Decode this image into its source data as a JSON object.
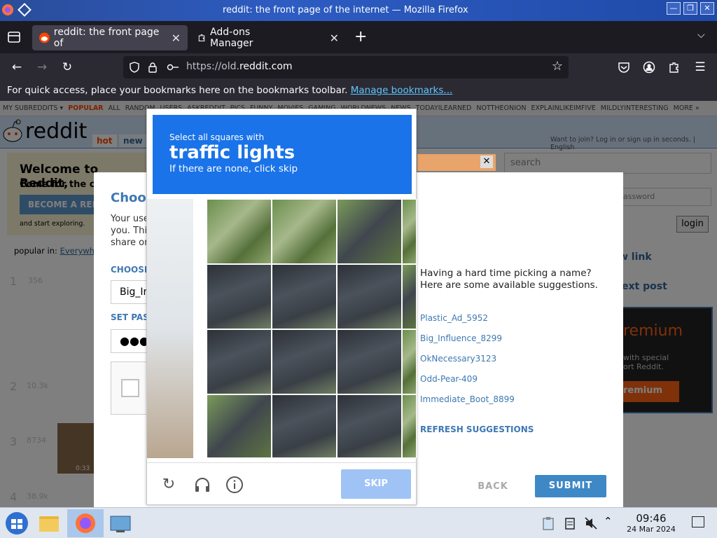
{
  "window": {
    "title": "reddit: the front page of the internet — Mozilla Firefox",
    "controls": [
      "—",
      "❐",
      "✕"
    ]
  },
  "tabs": [
    {
      "label": "reddit: the front page of",
      "close": "✕"
    },
    {
      "label": "Add-ons Manager",
      "close": "✕"
    }
  ],
  "new_tab": "+",
  "url": {
    "scheme": "https://old.",
    "host": "reddit.com"
  },
  "bookmarks": {
    "message": "For quick access, place your bookmarks here on the bookmarks toolbar.",
    "link": "Manage bookmarks..."
  },
  "reddit": {
    "subreddit_bar": [
      "MY SUBREDDITS ▾",
      "POPULAR",
      "ALL",
      "RANDOM",
      "USERS",
      "ASKREDDIT",
      "PICS",
      "FUNNY",
      "MOVIES",
      "GAMING",
      "WORLDNEWS",
      "NEWS",
      "TODAYILEARNED",
      "NOTTHEONION",
      "EXPLAINLIKEIMFIVE",
      "MILDLYINTERESTING",
      "MORE »"
    ],
    "logo_text": "reddit",
    "sort_tabs": [
      "hot",
      "new"
    ],
    "join_text": "Want to join? Log in or sign up in seconds. | English",
    "search_placeholder": "search",
    "password_placeholder": "password",
    "login": "login",
    "welcome_title": "Welcome to Reddit,",
    "welcome_sub": "Come for the ca",
    "become_button": "BECOME A RED",
    "start_exploring": "and start exploring.",
    "popular_in": "popular in:",
    "popular_in_link": "Everywhe",
    "ranks": [
      "1",
      "2",
      "3",
      "4"
    ],
    "scores": [
      "356",
      "•",
      "10.3k",
      "8734",
      "38.9k"
    ],
    "video_time": "0:33",
    "side_links": [
      "w link",
      "ext post"
    ],
    "premium_title": "remium",
    "premium_text": "with special\nort Reddit.",
    "premium_button": "remium"
  },
  "modal": {
    "title": "Choos",
    "desc": "Your use\nyou. Thi\nshare or",
    "choose_label": "CHOOSE",
    "username_value": "Big_In",
    "password_label": "SET PAS",
    "password_value": "●●●",
    "suggest_heading": "Having a hard time picking a name?\nHere are some available suggestions.",
    "suggestions": [
      "Plastic_Ad_5952",
      "Big_Influence_8299",
      "OkNecessary3123",
      "Odd-Pear-409",
      "Immediate_Boot_8899"
    ],
    "refresh": "REFRESH SUGGESTIONS",
    "back": "BACK",
    "submit": "SUBMIT"
  },
  "captcha": {
    "prompt": "Select all squares with",
    "target": "traffic lights",
    "hint": "If there are none, click skip",
    "skip": "SKIP",
    "tiles": 16
  },
  "taskbar": {
    "time": "09:46",
    "date": "24 Mar 2024"
  },
  "colors": {
    "accent": "#1a73e8",
    "reddit_blue": "#3e78b3",
    "reddit_orange": "#ff4500"
  }
}
